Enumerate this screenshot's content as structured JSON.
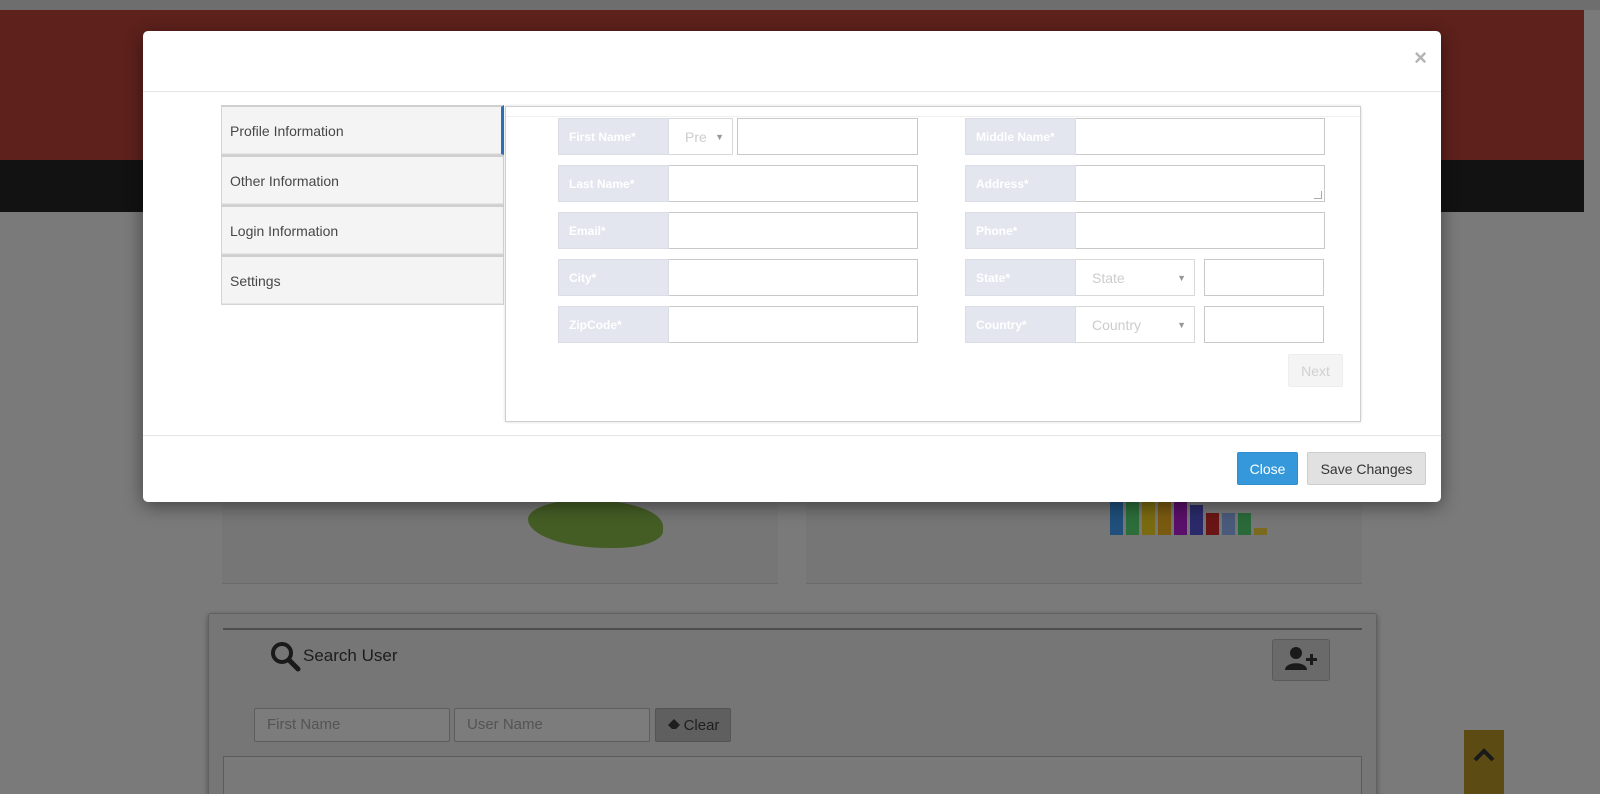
{
  "modal": {
    "close_symbol": "×",
    "tabs": [
      {
        "label": "Profile Information",
        "active": true
      },
      {
        "label": "Other Information",
        "active": false
      },
      {
        "label": "Login Information",
        "active": false
      },
      {
        "label": "Settings",
        "active": false
      }
    ],
    "form": {
      "first_name_label": "First Name*",
      "prefix_placeholder": "Pre",
      "middle_name_label": "Middle Name*",
      "last_name_label": "Last Name*",
      "address_label": "Address*",
      "email_label": "Email*",
      "phone_label": "Phone*",
      "city_label": "City*",
      "state_label": "State*",
      "state_placeholder": "State",
      "zipcode_label": "ZipCode*",
      "country_label": "Country*",
      "country_placeholder": "Country",
      "next_label": "Next"
    },
    "footer": {
      "close_label": "Close",
      "save_label": "Save Changes"
    }
  },
  "background": {
    "search_title": "Search User",
    "first_name_placeholder": "First Name",
    "user_name_placeholder": "User Name",
    "clear_label": "Clear"
  },
  "colors": {
    "accent": "#3498db",
    "header_bg": "#5e211c",
    "label_bg": "#e3e6ef",
    "tab_active_border": "#2f6fb6"
  },
  "icons": [
    "close-icon",
    "search-icon",
    "add-user-icon",
    "eraser-icon",
    "chevron-up-icon",
    "caret-down-icon"
  ]
}
